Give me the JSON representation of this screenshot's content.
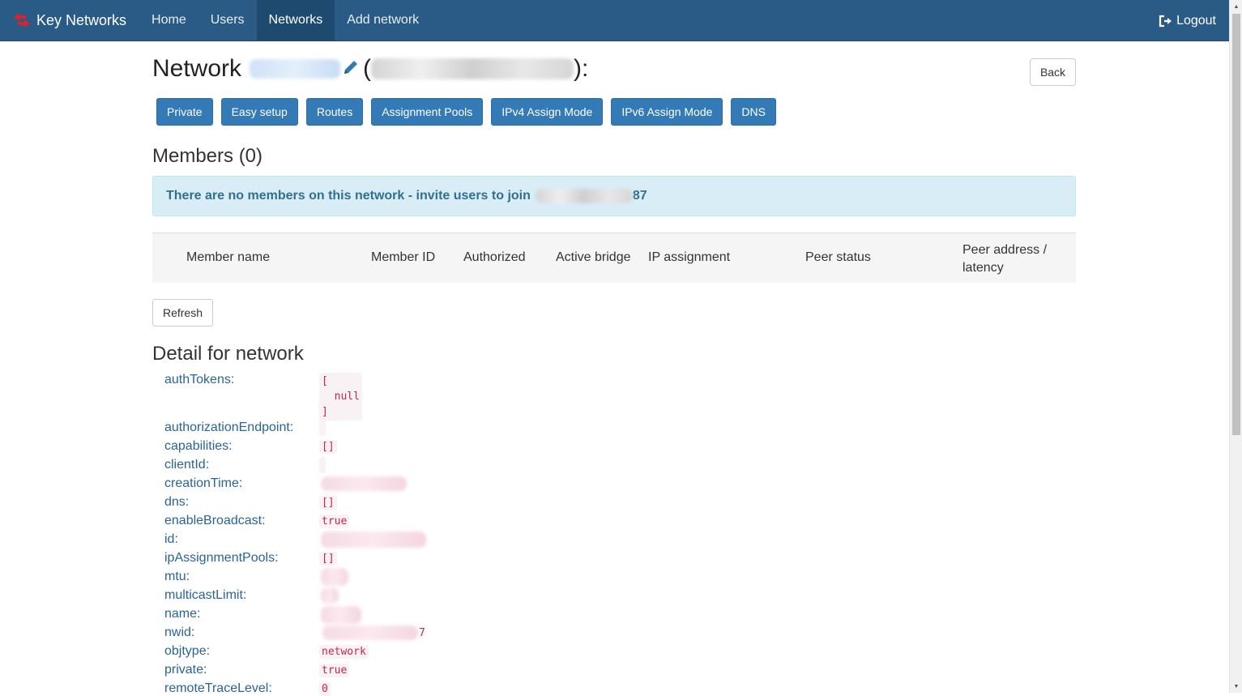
{
  "nav": {
    "brand": "Key Networks",
    "items": [
      {
        "label": "Home",
        "active": false
      },
      {
        "label": "Users",
        "active": false
      },
      {
        "label": "Networks",
        "active": true
      },
      {
        "label": "Add network",
        "active": false
      }
    ],
    "logout": "Logout"
  },
  "header": {
    "title_prefix": "Network",
    "open_paren": "(",
    "close_paren": "):",
    "back": "Back"
  },
  "actions": [
    "Private",
    "Easy setup",
    "Routes",
    "Assignment Pools",
    "IPv4 Assign Mode",
    "IPv6 Assign Mode",
    "DNS"
  ],
  "members": {
    "title": "Members (0)",
    "empty_message": "There are no members on this network - invite users to join",
    "empty_suffix": "87",
    "columns": [
      "Member name",
      "Member ID",
      "Authorized",
      "Active bridge",
      "IP assignment",
      "Peer status",
      "Peer address / latency"
    ],
    "refresh": "Refresh"
  },
  "detail": {
    "title": "Detail for network",
    "rows": [
      {
        "key": "authTokens:",
        "value": "[\n  null\n]"
      },
      {
        "key": "authorizationEndpoint:",
        "value": ""
      },
      {
        "key": "capabilities:",
        "value": "[]"
      },
      {
        "key": "clientId:",
        "value": ""
      },
      {
        "key": "creationTime:",
        "value": ""
      },
      {
        "key": "dns:",
        "value": "[]"
      },
      {
        "key": "enableBroadcast:",
        "value": "true"
      },
      {
        "key": "id:",
        "value": ""
      },
      {
        "key": "ipAssignmentPools:",
        "value": "[]"
      },
      {
        "key": "mtu:",
        "value": ""
      },
      {
        "key": "multicastLimit:",
        "value": ""
      },
      {
        "key": "name:",
        "value": ""
      },
      {
        "key": "nwid:",
        "value": "7"
      },
      {
        "key": "objtype:",
        "value": "network"
      },
      {
        "key": "private:",
        "value": "true"
      },
      {
        "key": "remoteTraceLevel:",
        "value": "0"
      }
    ]
  },
  "colors": {
    "navbar": "#2a5a86",
    "primary": "#337ab7",
    "alert_bg": "#d9edf7",
    "alert_text": "#31708f",
    "code_text": "#c7254e"
  }
}
